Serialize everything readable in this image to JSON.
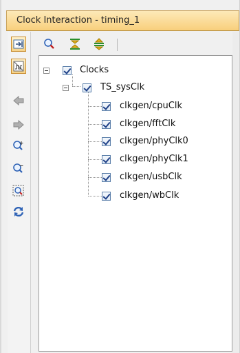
{
  "window": {
    "title": "Clock Interaction - timing_1"
  },
  "toolbar_left": {
    "items": [
      {
        "icon": "expand-pane-icon",
        "active": true
      },
      {
        "icon": "clock-settings-icon",
        "active": true
      },
      {
        "icon": "arrow-left-icon"
      },
      {
        "icon": "arrow-right-icon"
      },
      {
        "icon": "zoom-in-icon"
      },
      {
        "icon": "zoom-out-icon"
      },
      {
        "icon": "zoom-fit-icon"
      },
      {
        "icon": "refresh-icon"
      }
    ]
  },
  "toolbar_top": {
    "items": [
      {
        "icon": "search-icon"
      },
      {
        "icon": "collapse-all-icon"
      },
      {
        "icon": "expand-all-icon"
      }
    ]
  },
  "tree": {
    "root": {
      "label": "Clocks",
      "checked": true,
      "expanded": true
    },
    "group": {
      "label": "TS_sysClk",
      "checked": true,
      "expanded": true
    },
    "leaves": [
      {
        "label": "clkgen/cpuClk",
        "checked": true
      },
      {
        "label": "clkgen/fftClk",
        "checked": true
      },
      {
        "label": "clkgen/phyClk0",
        "checked": true
      },
      {
        "label": "clkgen/phyClk1",
        "checked": true
      },
      {
        "label": "clkgen/usbClk",
        "checked": true
      },
      {
        "label": "clkgen/wbClk",
        "checked": true
      }
    ]
  },
  "colors": {
    "titlebar": "#f8cf7c",
    "checkbox_mark": "#1d3f86",
    "panel_border": "#9a9a9a"
  }
}
